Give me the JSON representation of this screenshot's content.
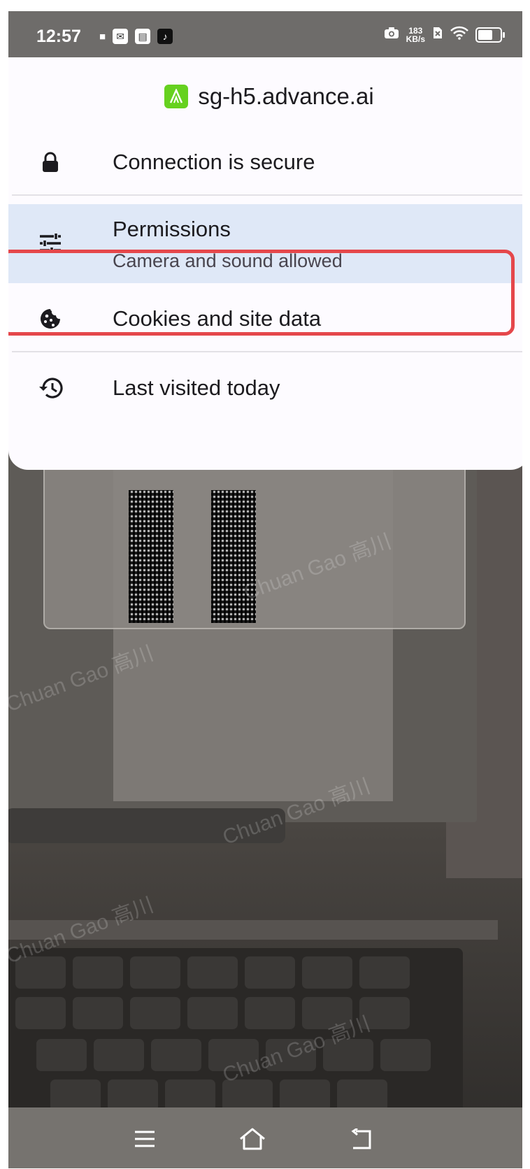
{
  "status_bar": {
    "time": "12:57",
    "net_speed_value": "183",
    "net_speed_unit": "KB/s"
  },
  "site_info": {
    "domain": "sg-h5.advance.ai",
    "site_icon_color": "#66d11f",
    "items": [
      {
        "icon": "lock-icon",
        "title": "Connection is secure"
      },
      {
        "icon": "tune-icon",
        "title": "Permissions",
        "subtitle": "Camera and sound allowed"
      },
      {
        "icon": "cookie-icon",
        "title": "Cookies and site data"
      },
      {
        "icon": "history-icon",
        "title": "Last visited today"
      }
    ]
  },
  "colors": {
    "highlight": "#e5474b",
    "selected_row": "#dfe8f7"
  },
  "watermark": {
    "text": "Chuan Gao 高川"
  },
  "nav_bar": {
    "buttons": [
      "menu-icon",
      "home-icon",
      "back-icon"
    ]
  }
}
